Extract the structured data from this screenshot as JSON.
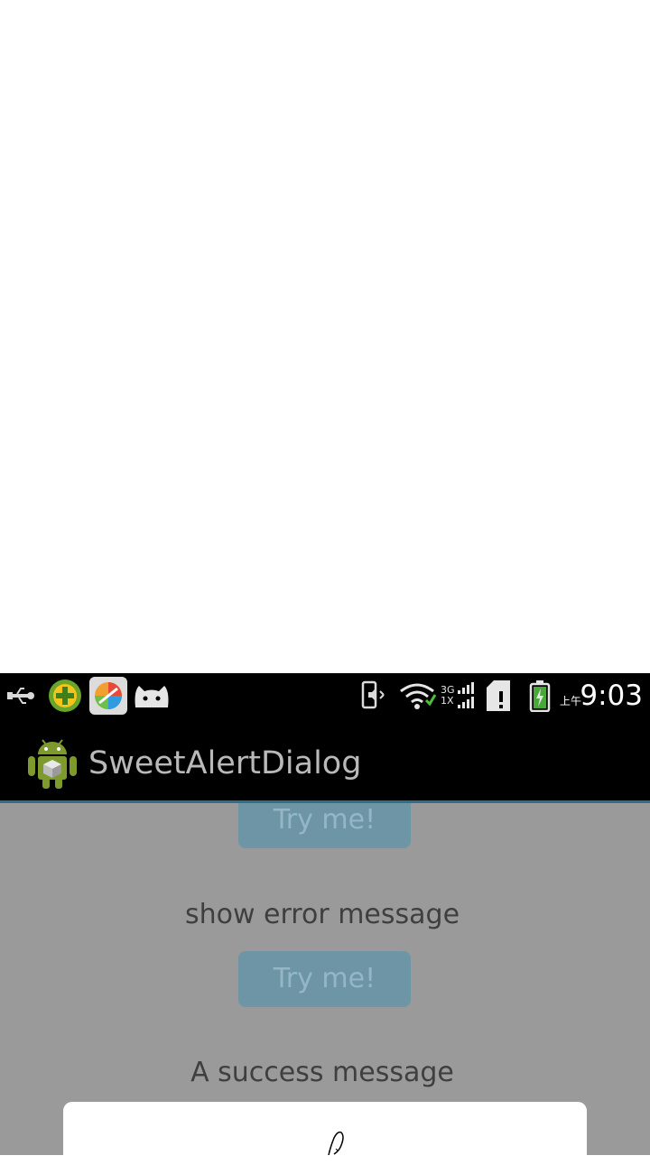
{
  "status_bar": {
    "time": "9:03",
    "ampm": "上午",
    "network_top": "3G",
    "network_bottom": "1X",
    "icons": [
      "usb-icon",
      "shield-plus-icon",
      "app-store-icon",
      "cat-face-icon",
      "vibrate-icon",
      "wifi-icon",
      "signal-icon",
      "sim-alert-icon",
      "battery-charging-icon"
    ]
  },
  "action_bar": {
    "title": "SweetAlertDialog",
    "accent": "#2f6f8c"
  },
  "content": {
    "top_button_label": "Try me!",
    "error_label": "show error message",
    "error_button_label": "Try me!",
    "success_label": "A success message"
  },
  "colors": {
    "overlay_bg": "#9a9a9a",
    "button_bg": "#6e95a6",
    "button_text": "#94b6c6"
  }
}
